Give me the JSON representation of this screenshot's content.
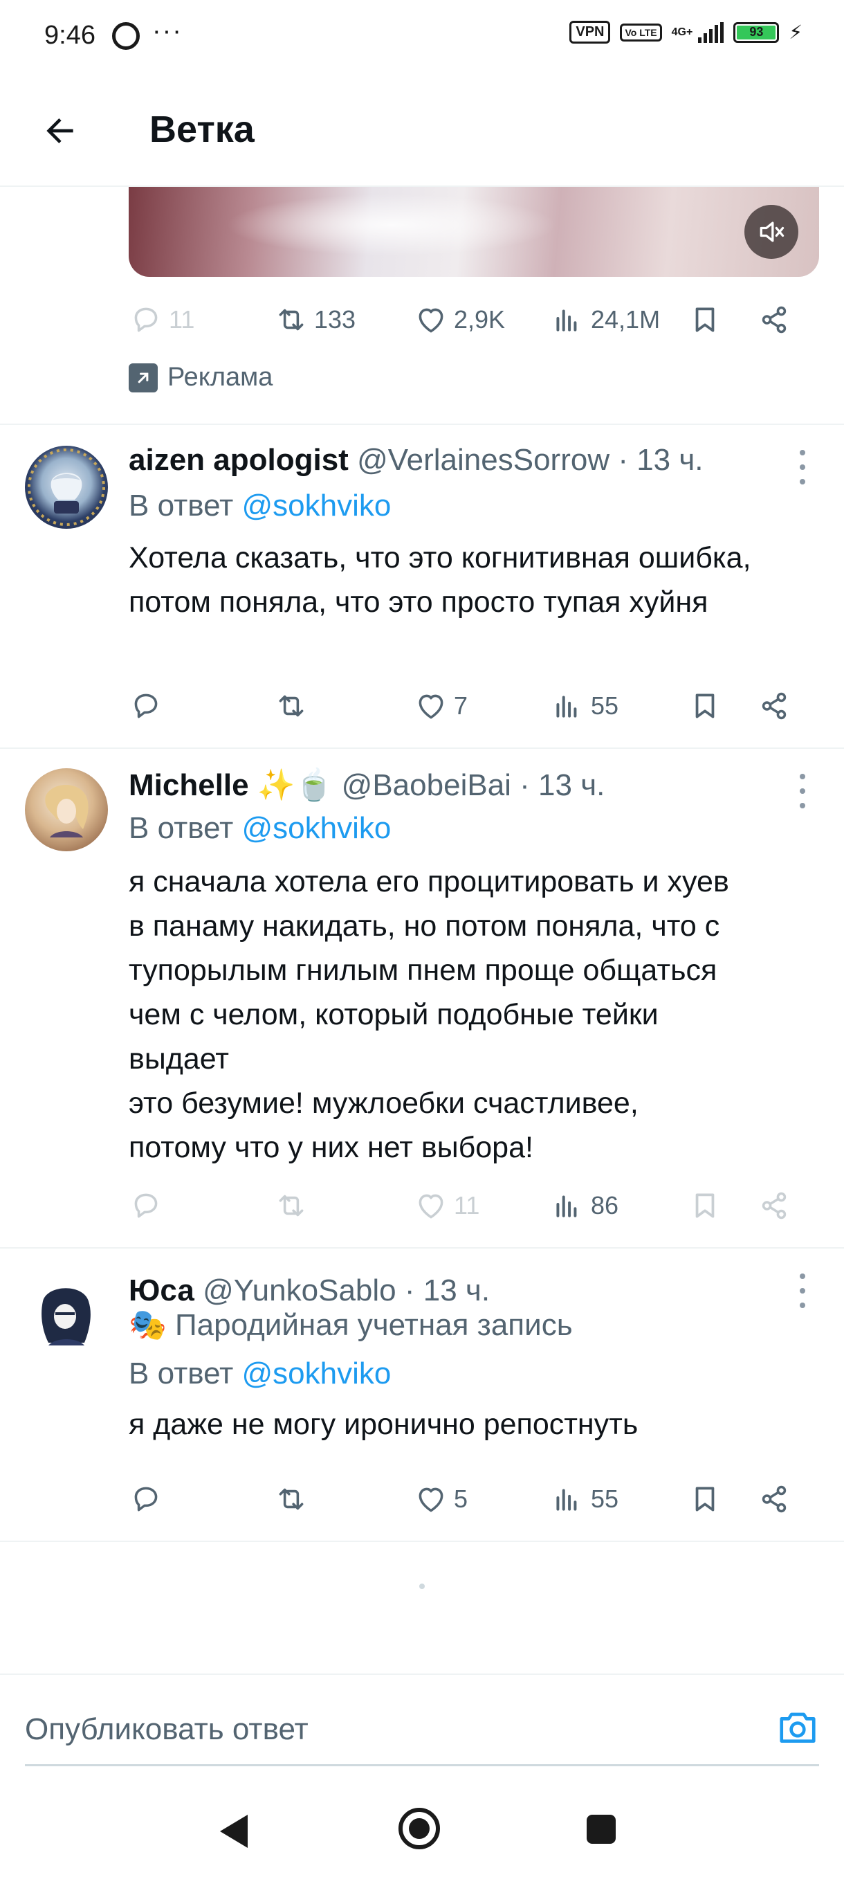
{
  "status_bar": {
    "time": "9:46",
    "dots": "···",
    "vpn": "VPN",
    "volte": "Vo LTE",
    "network": "4G+",
    "battery": "93"
  },
  "header": {
    "title": "Ветка"
  },
  "main_tweet": {
    "stats": {
      "replies": "11",
      "reposts": "133",
      "likes": "2,9K",
      "views": "24,1M"
    },
    "ad_label": "Реклама"
  },
  "replies": [
    {
      "name": "aizen apologist",
      "handle": "@VerlainesSorrow · 13 ч.",
      "reply_to_prefix": "В ответ",
      "reply_to": "@sokhviko",
      "text": "Хотела сказать, что это когнитивная ошибка, потом поняла, что это просто тупая хуйня",
      "stats": {
        "replies": "",
        "reposts": "",
        "likes": "7",
        "views": "55"
      }
    },
    {
      "name": "Michelle",
      "name_emoji": "✨🍵",
      "handle": "@BaobeiBai · 13 ч.",
      "reply_to_prefix": "В ответ",
      "reply_to": "@sokhviko",
      "text_lines": [
        "я сначала хотела его процитировать и хуев",
        "в панаму накидать, но потом поняла, что с",
        "тупорылым гнилым пнем проще общаться",
        "чем с челом, который подобные тейки",
        "выдает",
        "это безумие! мужлоебки счастливее,",
        "потому что у них нет выбора!"
      ],
      "stats": {
        "replies": "",
        "reposts": "",
        "likes": "11",
        "views": "86"
      }
    },
    {
      "name": "Юса",
      "handle": "@YunkoSablo · 13 ч.",
      "parody_label": "Пародийная учетная запись",
      "reply_to_prefix": "В ответ",
      "reply_to": "@sokhviko",
      "text": "я даже не могу иронично репостнуть",
      "stats": {
        "replies": "",
        "reposts": "",
        "likes": "5",
        "views": "55"
      }
    }
  ],
  "composer": {
    "placeholder": "Опубликовать ответ"
  },
  "colors": {
    "accent": "#1d9bf0",
    "muted": "#536471",
    "text": "#0f1419",
    "divider": "#eff3f4"
  }
}
